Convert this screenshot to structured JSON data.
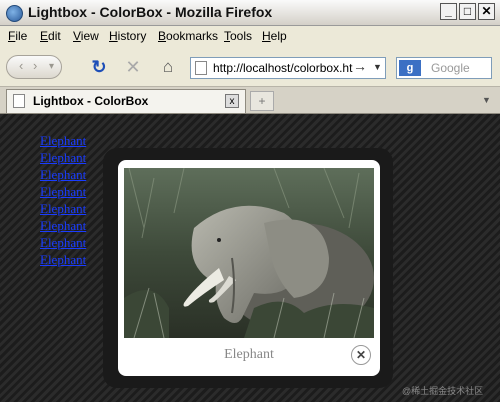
{
  "window": {
    "title": "Lightbox - ColorBox - Mozilla Firefox",
    "controls": {
      "minimize": "_",
      "maximize": "□",
      "close": "✕"
    }
  },
  "menu": [
    {
      "underline": "F",
      "rest": "ile"
    },
    {
      "underline": "E",
      "rest": "dit"
    },
    {
      "underline": "V",
      "rest": "iew"
    },
    {
      "underline": "H",
      "rest": "istory"
    },
    {
      "underline": "B",
      "rest": "ookmarks"
    },
    {
      "underline": "T",
      "rest": "ools"
    },
    {
      "underline": "H",
      "rest": "elp"
    }
  ],
  "toolbar": {
    "back": "‹",
    "forward": "›",
    "dropdown": "▾",
    "reload": "↻",
    "stop": "✕",
    "home": "⌂",
    "url": "http://localhost/colorbox.ht",
    "go": "→",
    "url_dropdown": "▼",
    "search_engine": "g",
    "search_placeholder": "Google"
  },
  "tabs": {
    "active": "Lightbox - ColorBox",
    "close": "x",
    "new_tab": "+",
    "list": "▼"
  },
  "links": [
    "Elephant",
    "Elephant",
    "Elephant",
    "Elephant",
    "Elephant",
    "Elephant",
    "Elephant",
    "Elephant"
  ],
  "lightbox": {
    "caption": "Elephant",
    "close": "✕"
  },
  "watermark": "@稀土掘金技术社区",
  "colors": {
    "link": "#1a3cff",
    "background": "#2b2b2b",
    "lightbox_frame": "#1a1a1a"
  }
}
